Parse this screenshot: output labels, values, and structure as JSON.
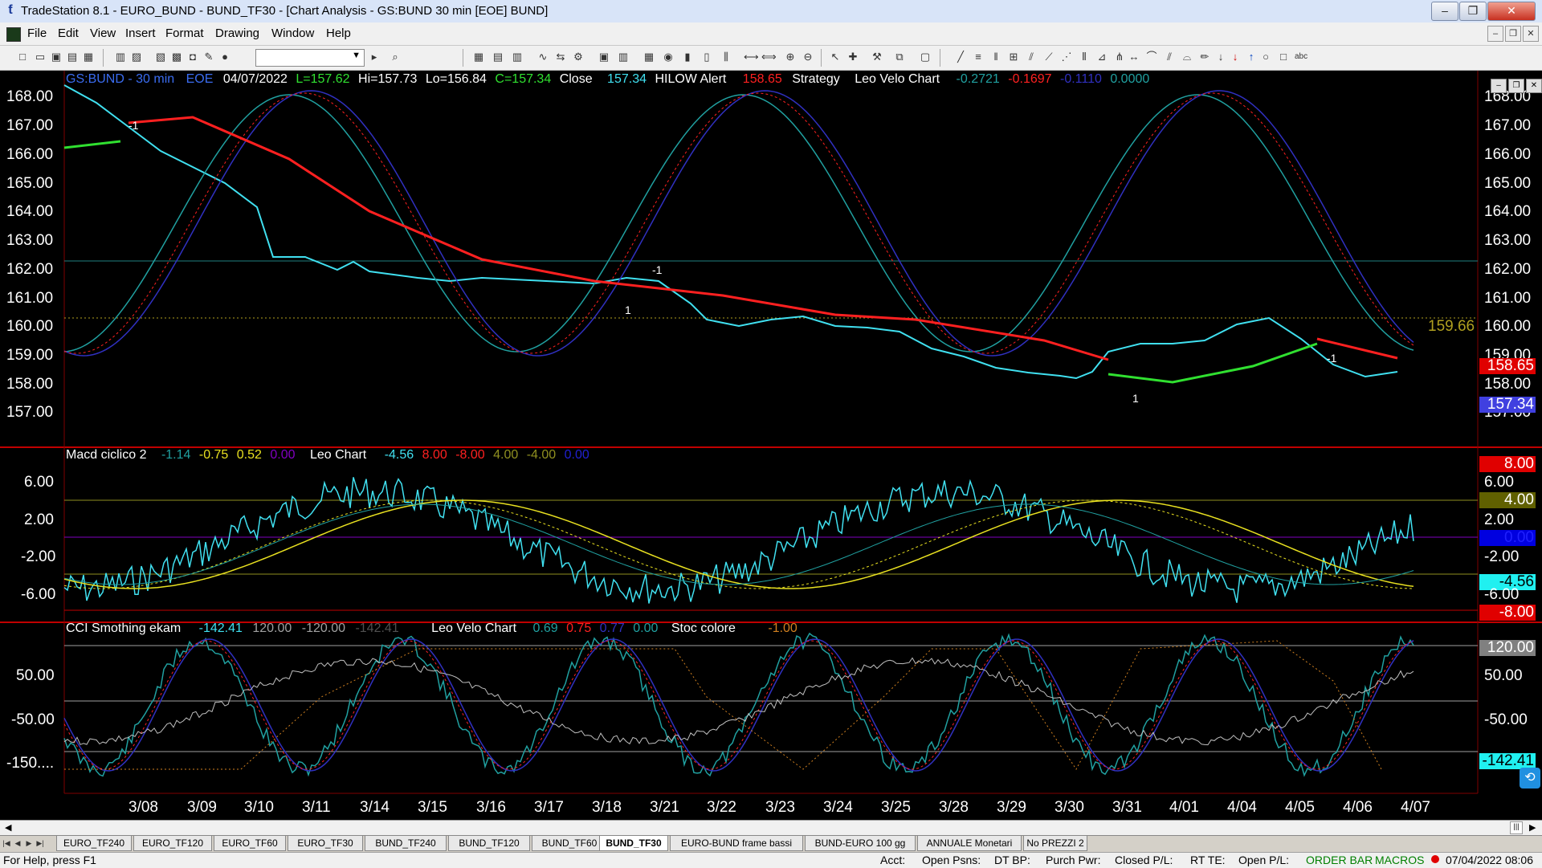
{
  "window": {
    "title": "TradeStation 8.1 - EURO_BUND - BUND_TF30 - [Chart Analysis - GS:BUND  30 min  [EOE] BUND]",
    "app_icon": "tradestation-icon",
    "minimize": "‒",
    "restore": "❐",
    "close": "✕"
  },
  "menu": {
    "items": [
      "File",
      "Edit",
      "View",
      "Insert",
      "Format",
      "Drawing",
      "Window",
      "Help"
    ],
    "mdi_minimize": "‒",
    "mdi_restore": "❐",
    "mdi_close": "✕"
  },
  "toolbar": {
    "symbol_value": "",
    "symbol_dropdown_icon": "chevron-down-icon"
  },
  "price_pane": {
    "header": {
      "symbol": "GS:BUND - 30 min",
      "session": "EOE",
      "date": "04/07/2022",
      "last": "L=157.62",
      "high": "Hi=157.73",
      "low": "Lo=156.84",
      "close_value": "C=157.34",
      "close_label": "Close",
      "close_price": "157.34",
      "hilow_label": "HILOW Alert",
      "hilow_value": "158.65",
      "strategy_label": "Strategy",
      "velo_label": "Leo Velo Chart",
      "velo_v1": "-0.2721",
      "velo_v2": "-0.1697",
      "velo_v3": "-0.1110",
      "velo_v4": "0.0000"
    },
    "y_labels": [
      "168.00",
      "167.00",
      "166.00",
      "165.00",
      "164.00",
      "163.00",
      "162.00",
      "161.00",
      "160.00",
      "159.00",
      "158.00",
      "157.00"
    ],
    "right_labels": [
      "168.00",
      "167.00",
      "166.00",
      "165.00",
      "164.00",
      "163.00",
      "162.00",
      "161.00",
      "160.00",
      "159.00",
      "158.00",
      "157.00"
    ],
    "ref_level": "159.66",
    "hilow_box": "158.65",
    "last_box": "157.34",
    "signals": [
      "-1",
      "1",
      "-1",
      "1",
      "-1"
    ]
  },
  "macd_pane": {
    "header": {
      "name": "Macd ciclico 2",
      "v1": "-1.14",
      "v2": "-0.75",
      "v3": "0.52",
      "v4": "0.00",
      "leo_label": "Leo Chart",
      "l1": "-4.56",
      "l2": "8.00",
      "l3": "-8.00",
      "l4": "4.00",
      "l5": "-4.00",
      "l6": "0.00"
    },
    "y_labels": [
      "6.00",
      "2.00",
      "-2.00",
      "-6.00"
    ],
    "right_labels": [
      "8.00",
      "6.00",
      "4.00",
      "2.00",
      "0.00",
      "-2.00",
      "-4.56",
      "-6.00",
      "-8.00"
    ]
  },
  "cci_pane": {
    "header": {
      "name": "CCI Smothing ekam",
      "v1": "-142.41",
      "v2": "120.00",
      "v3": "-120.00",
      "v4": "-142.41",
      "velo_label": "Leo Velo Chart",
      "vv1": "0.69",
      "vv2": "0.75",
      "vv3": "0.77",
      "vv4": "0.00",
      "stoc_label": "Stoc colore",
      "stoc_value": "-1.00"
    },
    "y_labels": [
      "50.00",
      "-50.00",
      "-150...."
    ],
    "right_labels": [
      "120.00",
      "50.00",
      "-50.00",
      "-142.41"
    ]
  },
  "x_axis": {
    "labels": [
      "3/08",
      "3/09",
      "3/10",
      "3/11",
      "3/14",
      "3/15",
      "3/16",
      "3/17",
      "3/18",
      "3/21",
      "3/22",
      "3/23",
      "3/24",
      "3/25",
      "3/28",
      "3/29",
      "3/30",
      "3/31",
      "4/01",
      "4/04",
      "4/05",
      "4/06",
      "4/07"
    ]
  },
  "tabs": {
    "items": [
      "EURO_TF240",
      "EURO_TF120",
      "EURO_TF60",
      "EURO_TF30",
      "BUND_TF240",
      "BUND_TF120",
      "BUND_TF60",
      "BUND_TF30",
      "EURO-BUND frame bassi",
      "BUND-EURO 100 gg",
      "ANNUALE Monetari",
      "No PREZZI 2"
    ],
    "active": "BUND_TF30"
  },
  "status": {
    "help": "For Help, press F1",
    "acct": "Acct:",
    "open_psns": "Open Psns:",
    "dt_bp": "DT BP:",
    "purch_pwr": "Purch Pwr:",
    "closed_pl": "Closed P/L:",
    "rt_te": "RT TE:",
    "open_pl": "Open P/L:",
    "order_bar": "ORDER BAR",
    "macros": "MACROS",
    "datetime": "07/04/2022 08:06"
  },
  "colors": {
    "price": "#40e0f0",
    "ma_red": "#ff2020",
    "ma_green": "#30e030",
    "osc_blue": "#3030c0",
    "osc_teal": "#20a0a0",
    "yellow": "#e8e020",
    "violet": "#8000c0"
  }
}
